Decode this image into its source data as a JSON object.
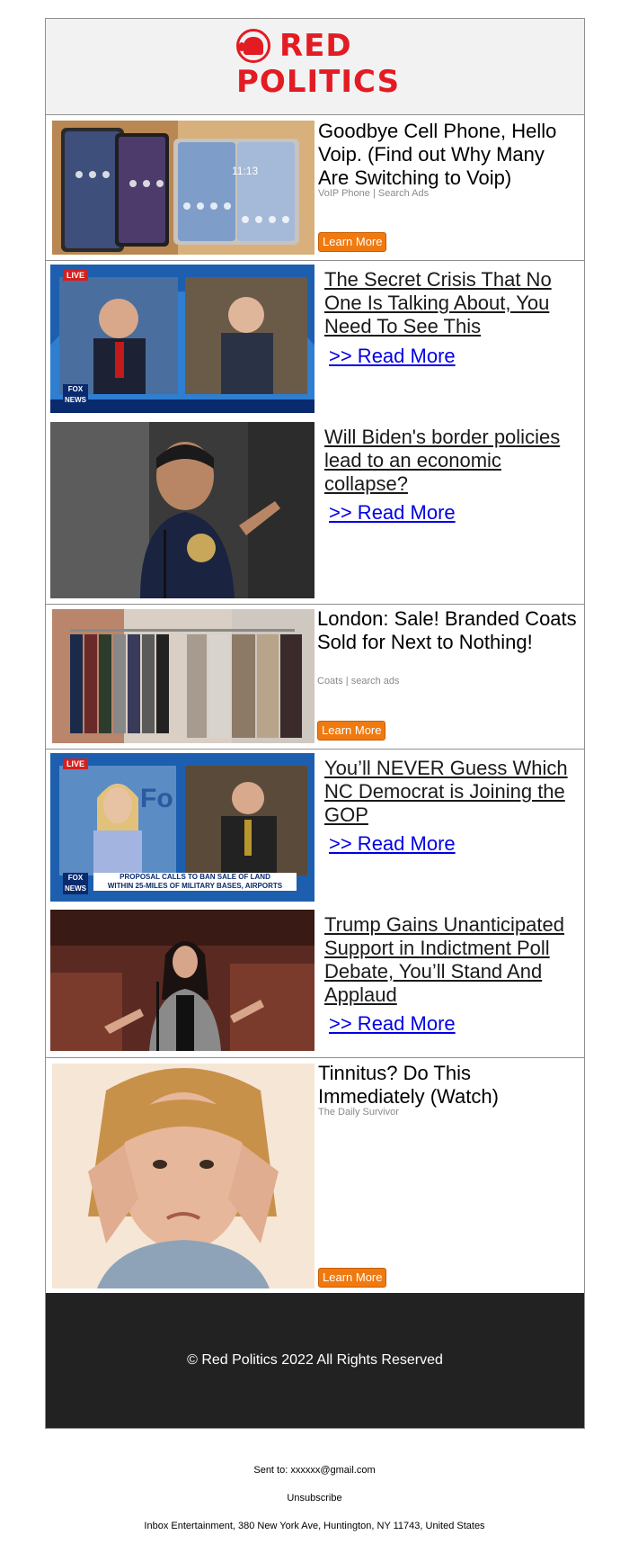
{
  "brand": {
    "line1": "RED",
    "line2": "POLITICS",
    "color": "#e31b23"
  },
  "ads": [
    {
      "title": "Goodbye Cell Phone, Hello Voip. (Find out Why Many Are Switching to Voip)",
      "source": "VoIP Phone | Search Ads",
      "cta": "Learn More",
      "image": "foldable-phones-image"
    },
    {
      "title": "London: Sale! Branded Coats Sold for Next to Nothing!",
      "source": "Coats | search ads",
      "cta": "Learn More",
      "image": "coats-rack-image"
    },
    {
      "title": "Tinnitus? Do This Immediately (Watch)",
      "source": "The Daily Survivor",
      "cta": "Learn More",
      "image": "woman-covering-ears-image"
    }
  ],
  "articles": [
    {
      "title": "The Secret Crisis That No One Is Talking About, You Need To See This",
      "read_more": ">> Read More",
      "image": "fox-news-interview-image"
    },
    {
      "title": "Will Biden's border policies lead to an economic collapse?",
      "read_more": ">> Read More",
      "image": "speaker-at-podium-image"
    },
    {
      "title": "You’ll NEVER Guess Which NC Democrat is Joining the GOP",
      "read_more": ">> Read More",
      "image": "fox-friends-interview-image"
    },
    {
      "title": "Trump Gains Unanticipated Support in Indictment Poll Debate, You’ll Stand And Applaud",
      "read_more": ">> Read More",
      "image": "congresswoman-speaking-image"
    }
  ],
  "tv": {
    "live": "LIVE",
    "network": "FOX NEWS",
    "ticker1": "PROPOSAL CALLS TO BAN SALE OF LAND",
    "ticker2": "WITHIN 25-MILES OF MILITARY BASES, AIRPORTS"
  },
  "footer": {
    "copyright": "© Red Politics 2022 All Rights Reserved",
    "sent_to": "Sent to: xxxxxx@gmail.com",
    "unsubscribe": "Unsubscribe",
    "address": "Inbox Entertainment, 380 New York Ave, Huntington, NY 11743, United States"
  },
  "colors": {
    "cta": "#f07a10",
    "link": "#0000e6",
    "footer_bg": "#222222"
  }
}
